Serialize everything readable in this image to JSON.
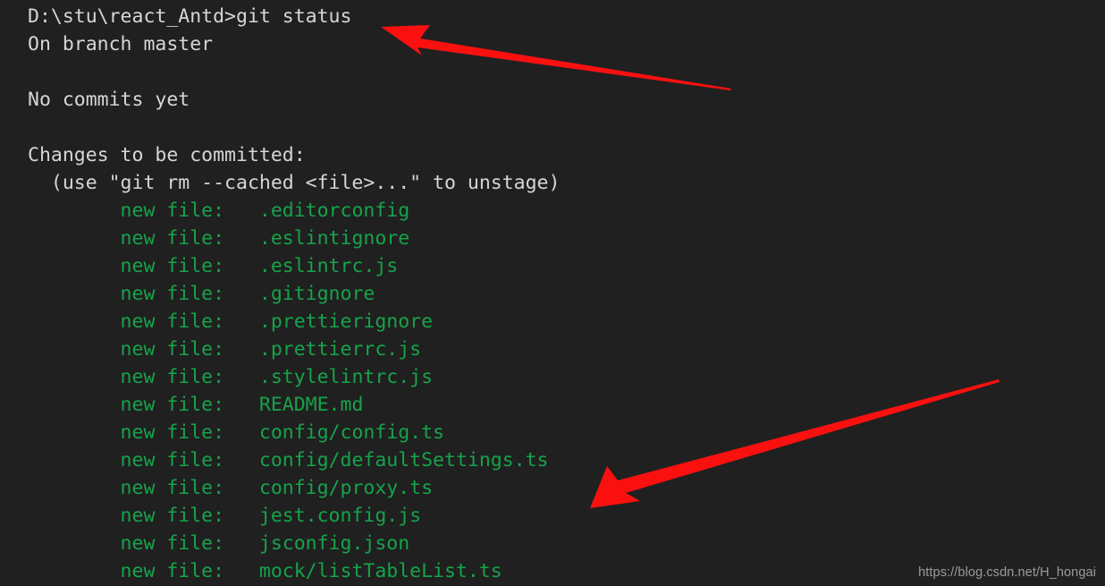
{
  "terminal": {
    "background_color": "#202020",
    "text_color": "#d6d6d6",
    "added_color": "#16a34a",
    "arrow_color": "#fb1010",
    "lines": [
      {
        "kind": "prompt",
        "text": "D:\\stu\\react_Antd>git status"
      },
      {
        "kind": "plain",
        "text": "On branch master"
      },
      {
        "kind": "blank",
        "text": " "
      },
      {
        "kind": "plain",
        "text": "No commits yet"
      },
      {
        "kind": "blank",
        "text": " "
      },
      {
        "kind": "plain",
        "text": "Changes to be committed:"
      },
      {
        "kind": "plain",
        "text": "  (use \"git rm --cached <file>...\" to unstage)"
      },
      {
        "kind": "added",
        "status": "        new file:   ",
        "file": ".editorconfig"
      },
      {
        "kind": "added",
        "status": "        new file:   ",
        "file": ".eslintignore"
      },
      {
        "kind": "added",
        "status": "        new file:   ",
        "file": ".eslintrc.js"
      },
      {
        "kind": "added",
        "status": "        new file:   ",
        "file": ".gitignore"
      },
      {
        "kind": "added",
        "status": "        new file:   ",
        "file": ".prettierignore"
      },
      {
        "kind": "added",
        "status": "        new file:   ",
        "file": ".prettierrc.js"
      },
      {
        "kind": "added",
        "status": "        new file:   ",
        "file": ".stylelintrc.js"
      },
      {
        "kind": "added",
        "status": "        new file:   ",
        "file": "README.md"
      },
      {
        "kind": "added",
        "status": "        new file:   ",
        "file": "config/config.ts"
      },
      {
        "kind": "added",
        "status": "        new file:   ",
        "file": "config/defaultSettings.ts"
      },
      {
        "kind": "added",
        "status": "        new file:   ",
        "file": "config/proxy.ts"
      },
      {
        "kind": "added",
        "status": "        new file:   ",
        "file": "jest.config.js"
      },
      {
        "kind": "added",
        "status": "        new file:   ",
        "file": "jsconfig.json"
      },
      {
        "kind": "added",
        "status": "        new file:   ",
        "file": "mock/listTableList.ts"
      }
    ]
  },
  "annotations": {
    "arrow_top": {
      "label": "arrow pointing to git status command"
    },
    "arrow_bottom": {
      "label": "arrow pointing to staged file list"
    }
  },
  "watermark": {
    "text": "https://blog.csdn.net/H_hongai"
  }
}
